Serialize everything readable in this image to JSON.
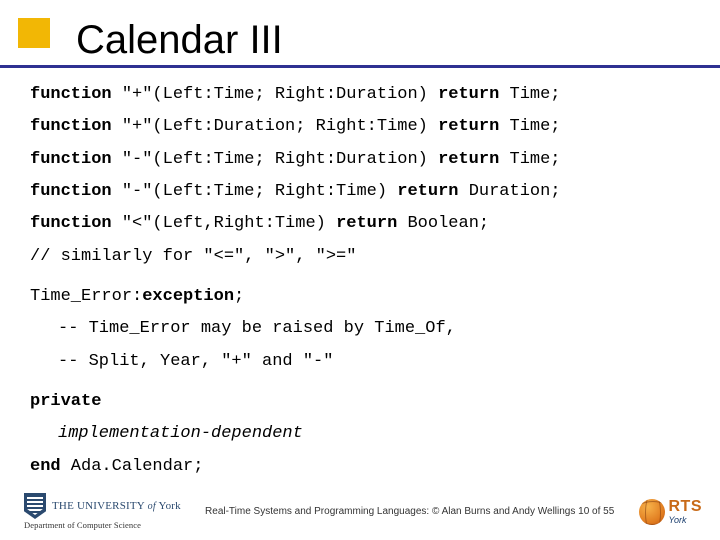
{
  "title": "Calendar III",
  "lines": {
    "l1_kw": "function",
    "l1_rest": " \"+\"(Left:Time; Right:Duration) ",
    "l1_ret": "return",
    "l1_end": " Time;",
    "l2_kw": "function",
    "l2_rest": " \"+\"(Left:Duration; Right:Time) ",
    "l2_ret": "return",
    "l2_end": " Time;",
    "l3_kw": "function",
    "l3_rest": " \"-\"(Left:Time; Right:Duration) ",
    "l3_ret": "return",
    "l3_end": " Time;",
    "l4_kw": "function",
    "l4_rest": " \"-\"(Left:Time; Right:Time) ",
    "l4_ret": "return",
    "l4_end": " Duration;",
    "l5_kw": "function",
    "l5_rest": " \"<\"(Left,Right:Time) ",
    "l5_ret": "return",
    "l5_end": " Boolean;",
    "l6": "// similarly for \"<=\", \">\", \">=\"",
    "l7a": "Time_Error:",
    "l7b": "exception",
    "l7c": ";",
    "l8": "-- Time_Error may be raised by Time_Of,",
    "l9": "-- Split, Year, \"+\" and \"-\"",
    "l10": "private",
    "l11": "implementation-dependent",
    "l12a": "end",
    "l12b": " Ada.Calendar;"
  },
  "footer": {
    "uni_the": "THE ",
    "uni_univ": "UNIVERSITY",
    "uni_of": " of ",
    "uni_york": "York",
    "dept": "Department of Computer Science",
    "center": "Real-Time Systems and Programming Languages: © Alan Burns and Andy Wellings  10 of 55",
    "rts": "RTS",
    "rts_sub": "York"
  }
}
